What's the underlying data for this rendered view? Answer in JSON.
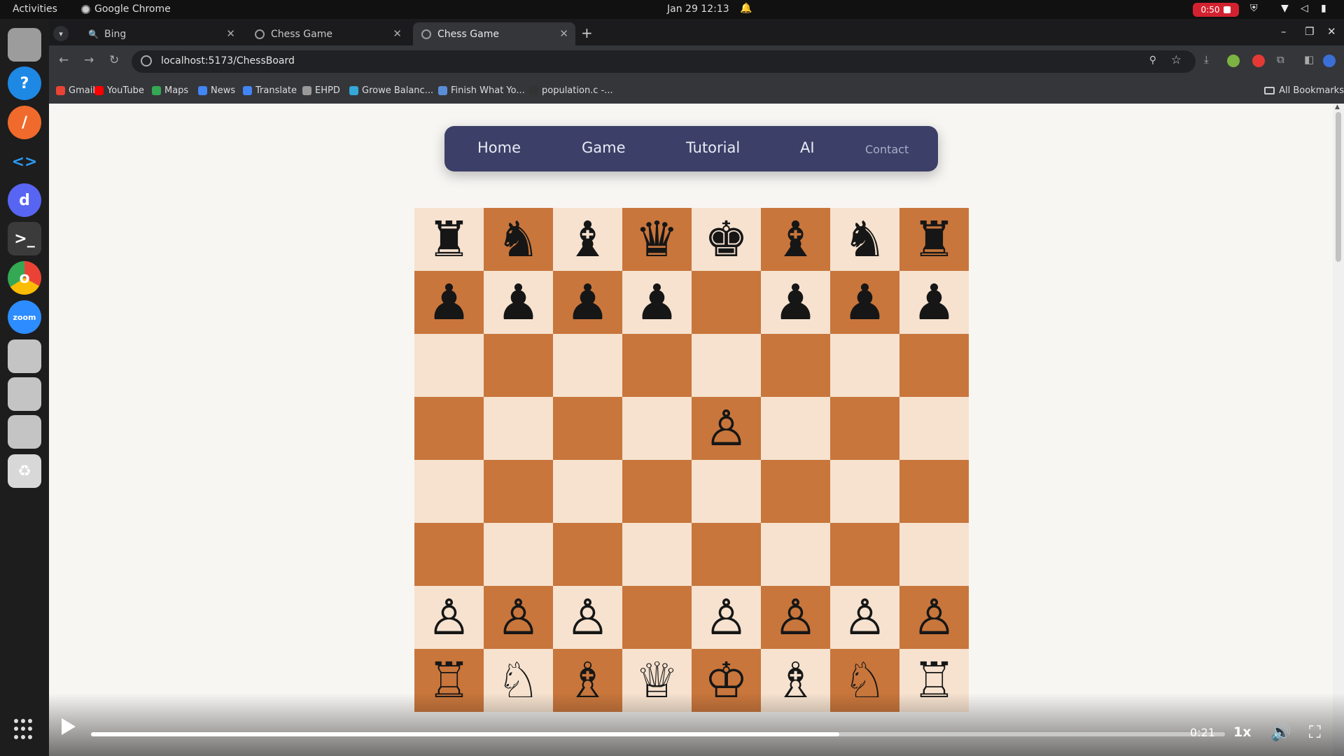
{
  "system_bar": {
    "activities": "Activities",
    "app_name": "Google Chrome",
    "clock": "Jan 29  12:13",
    "recording": "0:50"
  },
  "dock": {
    "apps": [
      {
        "name": "files",
        "color": "#9c9c9c",
        "glyph": ""
      },
      {
        "name": "help",
        "color": "#1e88e5",
        "glyph": "?"
      },
      {
        "name": "pen-tool",
        "color": "#f06a2b",
        "glyph": "/"
      },
      {
        "name": "vscode",
        "color": "#1d1d1d",
        "glyph": "<>"
      },
      {
        "name": "discord",
        "color": "#5865f2",
        "glyph": "d"
      },
      {
        "name": "terminal",
        "color": "#3b3b3b",
        "glyph": ">_"
      },
      {
        "name": "chrome",
        "color": "#ffffff",
        "glyph": "o"
      },
      {
        "name": "zoom",
        "color": "#2d8cff",
        "glyph": "zoom"
      },
      {
        "name": "doc-1",
        "color": "#c4c4c4",
        "glyph": ""
      },
      {
        "name": "doc-2",
        "color": "#c4c4c4",
        "glyph": ""
      },
      {
        "name": "doc-3",
        "color": "#c4c4c4",
        "glyph": ""
      },
      {
        "name": "trash",
        "color": "#d8d8d8",
        "glyph": "♻"
      }
    ]
  },
  "browser": {
    "tabs": [
      {
        "label": "Bing",
        "active": false
      },
      {
        "label": "Chess Game",
        "active": false
      },
      {
        "label": "Chess Game",
        "active": true
      }
    ],
    "url": "localhost:5173/ChessBoard",
    "bookmarks": [
      {
        "label": "Gmail",
        "color": "#ea4335"
      },
      {
        "label": "YouTube",
        "color": "#ff0000"
      },
      {
        "label": "Maps",
        "color": "#34a853"
      },
      {
        "label": "News",
        "color": "#4285f4"
      },
      {
        "label": "Translate",
        "color": "#4285f4"
      },
      {
        "label": "EHPD",
        "color": "#999999"
      },
      {
        "label": "Growe Balanc...",
        "color": "#34a8d8"
      },
      {
        "label": "Finish What Yo...",
        "color": "#5a8dd8"
      },
      {
        "label": "population.c -...",
        "color": "#333333"
      }
    ],
    "all_bookmarks": "All Bookmarks"
  },
  "site_nav": {
    "items": [
      "Home",
      "Game",
      "Tutorial",
      "AI",
      "Contact"
    ]
  },
  "board": {
    "rows": [
      [
        "♜",
        "♞",
        "♝",
        "♛",
        "♚",
        "♝",
        "♞",
        "♜"
      ],
      [
        "♟",
        "♟",
        "♟",
        "♟",
        "",
        "♟",
        "♟",
        "♟"
      ],
      [
        "",
        "",
        "",
        "",
        "",
        "",
        "",
        ""
      ],
      [
        "",
        "",
        "",
        "",
        "♙",
        "",
        "",
        ""
      ],
      [
        "",
        "",
        "",
        "",
        "",
        "",
        "",
        ""
      ],
      [
        "",
        "",
        "",
        "",
        "",
        "",
        "",
        ""
      ],
      [
        "♙",
        "♙",
        "♙",
        "",
        "♙",
        "♙",
        "♙",
        "♙"
      ],
      [
        "♖",
        "♘",
        "♗",
        "♕",
        "♔",
        "♗",
        "♘",
        "♖"
      ]
    ],
    "light_color": "#f6e2cf",
    "dark_color": "#c8763c"
  },
  "video_player": {
    "time": "0:21",
    "speed": "1x",
    "progress_fraction": 0.66
  }
}
